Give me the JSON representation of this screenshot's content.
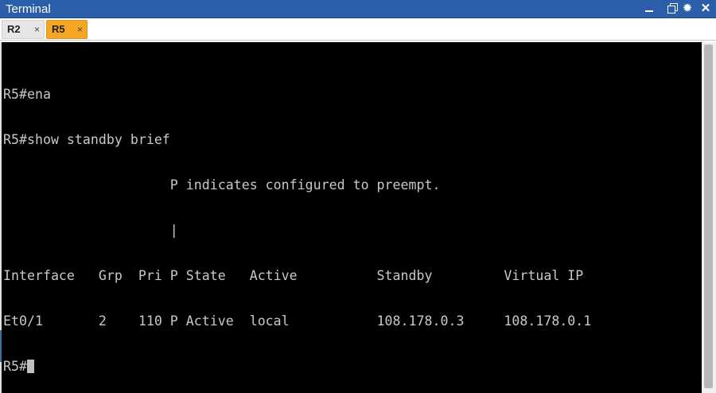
{
  "window": {
    "title": "Terminal",
    "controls": {
      "minimize_icon": "minimize-icon",
      "restore_icon": "restore-icon",
      "settings_glyph": "✹",
      "close_glyph": "✕"
    },
    "accent_color": "#2a5ea8"
  },
  "tabs": [
    {
      "label": "R2",
      "close": "×",
      "active": false
    },
    {
      "label": "R5",
      "close": "×",
      "active": true,
      "color": "#f5a623"
    }
  ],
  "terminal": {
    "lines": [
      "R5#ena",
      "R5#show standby brief",
      "                     P indicates configured to preempt.",
      "                     |",
      "Interface   Grp  Pri P State   Active          Standby         Virtual IP",
      "Et0/1       2    110 P Active  local           108.178.0.3     108.178.0.1"
    ],
    "prompt": "R5#"
  }
}
